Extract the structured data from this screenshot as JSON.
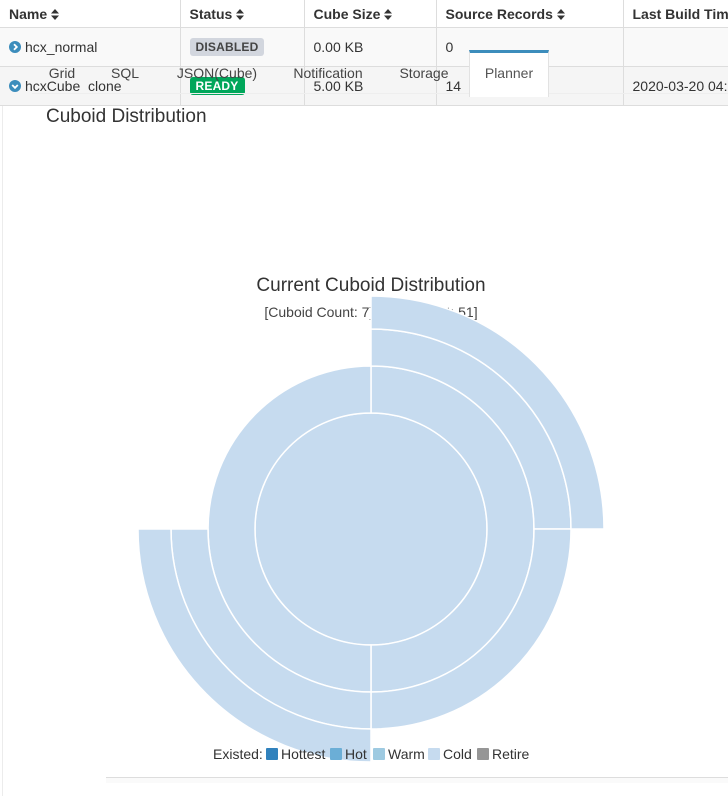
{
  "table": {
    "columns": [
      {
        "key": "name",
        "label": "Name"
      },
      {
        "key": "status",
        "label": "Status"
      },
      {
        "key": "size",
        "label": "Cube Size"
      },
      {
        "key": "records",
        "label": "Source Records"
      },
      {
        "key": "build",
        "label": "Last Build Tim"
      }
    ],
    "rows": [
      {
        "name": "hcx_normal",
        "status": "DISABLED",
        "size": "0.00 KB",
        "records": "0",
        "build": "",
        "expanded": false
      },
      {
        "name": "hcxCube_clone",
        "status": "READY",
        "size": "5.00 KB",
        "records": "14",
        "build": "2020-03-20 04:",
        "expanded": true
      }
    ]
  },
  "tabs": [
    "Grid",
    "SQL",
    "JSON(Cube)",
    "Notification",
    "Storage",
    "Planner"
  ],
  "active_tab": "Planner",
  "section_title": "Cuboid Distribution",
  "colors": {
    "accent": "#3c8dbc",
    "ready": "#00a65a",
    "disabled": "#d2d6de",
    "sunburst_fill": "#c6dbef"
  },
  "chart_data": {
    "type": "sunburst",
    "title": "Current Cuboid Distribution",
    "subtitle": "[Cuboid Count: 7] [Row Count: 51]",
    "legend_prefix": "Existed:",
    "legend": [
      {
        "name": "Hottest",
        "color": "#3182bd"
      },
      {
        "name": "Hot",
        "color": "#6baed6"
      },
      {
        "name": "Warm",
        "color": "#9ecae1"
      },
      {
        "name": "Cold",
        "color": "#c6dbef"
      },
      {
        "name": "Retire",
        "color": "#969696"
      }
    ],
    "legend_position": "bottom",
    "levels": [
      {
        "level": 0,
        "segments": [
          {
            "start_deg": 0,
            "end_deg": 360
          }
        ]
      },
      {
        "level": 1,
        "segments": [
          {
            "start_deg": 0,
            "end_deg": 180
          },
          {
            "start_deg": 180,
            "end_deg": 360
          }
        ]
      },
      {
        "level": 2,
        "segments": [
          {
            "start_deg": 0,
            "end_deg": 90
          },
          {
            "start_deg": 90,
            "end_deg": 180
          },
          {
            "start_deg": 180,
            "end_deg": 270
          }
        ]
      },
      {
        "level": 3,
        "segments": [
          {
            "start_deg": 0,
            "end_deg": 90
          },
          {
            "start_deg": 180,
            "end_deg": 270
          }
        ]
      }
    ]
  }
}
